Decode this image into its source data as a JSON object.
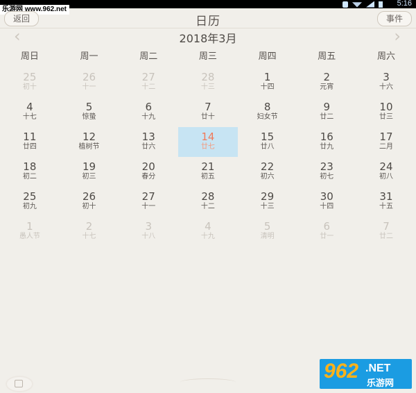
{
  "status_bar": {
    "time": "5:16"
  },
  "watermark": {
    "top_left": "乐游网 www.962.net",
    "brand_num": "962",
    "brand_net": ".NET",
    "brand_cn": "乐游网"
  },
  "header": {
    "title": "日历",
    "back_label": "返回",
    "event_label": "事件"
  },
  "nav": {
    "month": "2018年3月",
    "prev": "‹",
    "next": "›"
  },
  "weekdays": [
    "周日",
    "周一",
    "周二",
    "周三",
    "周四",
    "周五",
    "周六"
  ],
  "calendar": {
    "weeks": [
      [
        {
          "d": "25",
          "l": "初十",
          "m": true
        },
        {
          "d": "26",
          "l": "十一",
          "m": true
        },
        {
          "d": "27",
          "l": "十二",
          "m": true
        },
        {
          "d": "28",
          "l": "十三",
          "m": true
        },
        {
          "d": "1",
          "l": "十四"
        },
        {
          "d": "2",
          "l": "元宵"
        },
        {
          "d": "3",
          "l": "十六"
        }
      ],
      [
        {
          "d": "4",
          "l": "十七"
        },
        {
          "d": "5",
          "l": "惊蛰"
        },
        {
          "d": "6",
          "l": "十九"
        },
        {
          "d": "7",
          "l": "廿十"
        },
        {
          "d": "8",
          "l": "妇女节"
        },
        {
          "d": "9",
          "l": "廿二"
        },
        {
          "d": "10",
          "l": "廿三"
        }
      ],
      [
        {
          "d": "11",
          "l": "廿四"
        },
        {
          "d": "12",
          "l": "植树节"
        },
        {
          "d": "13",
          "l": "廿六"
        },
        {
          "d": "14",
          "l": "廿七",
          "today": true
        },
        {
          "d": "15",
          "l": "廿八"
        },
        {
          "d": "16",
          "l": "廿九"
        },
        {
          "d": "17",
          "l": "二月"
        }
      ],
      [
        {
          "d": "18",
          "l": "初二"
        },
        {
          "d": "19",
          "l": "初三"
        },
        {
          "d": "20",
          "l": "春分"
        },
        {
          "d": "21",
          "l": "初五"
        },
        {
          "d": "22",
          "l": "初六"
        },
        {
          "d": "23",
          "l": "初七"
        },
        {
          "d": "24",
          "l": "初八"
        }
      ],
      [
        {
          "d": "25",
          "l": "初九"
        },
        {
          "d": "26",
          "l": "初十"
        },
        {
          "d": "27",
          "l": "十一"
        },
        {
          "d": "28",
          "l": "十二"
        },
        {
          "d": "29",
          "l": "十三"
        },
        {
          "d": "30",
          "l": "十四"
        },
        {
          "d": "31",
          "l": "十五"
        }
      ],
      [
        {
          "d": "1",
          "l": "愚人节",
          "m": true
        },
        {
          "d": "2",
          "l": "十七",
          "m": true
        },
        {
          "d": "3",
          "l": "十八",
          "m": true
        },
        {
          "d": "4",
          "l": "十九",
          "m": true
        },
        {
          "d": "5",
          "l": "清明",
          "m": true
        },
        {
          "d": "6",
          "l": "廿一",
          "m": true
        },
        {
          "d": "7",
          "l": "廿二",
          "m": true
        }
      ]
    ]
  },
  "colors": {
    "background": "#f1efea",
    "today_bg": "#c7e4f3",
    "today_text": "#f07a5a",
    "muted_text": "#c8c3bc"
  }
}
